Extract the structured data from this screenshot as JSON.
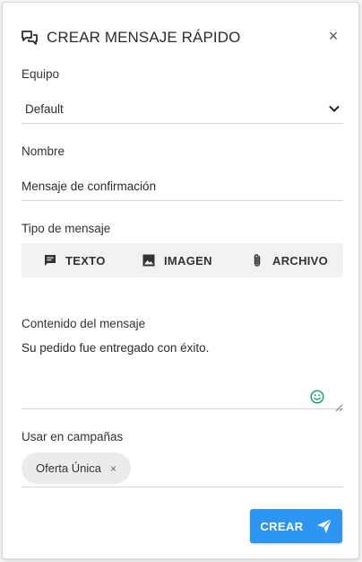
{
  "dialog": {
    "title": "CREAR MENSAJE RÁPIDO",
    "close_label": "×"
  },
  "team": {
    "label": "Equipo",
    "value": "Default"
  },
  "name": {
    "label": "Nombre",
    "value": "Mensaje de confirmación"
  },
  "message_type": {
    "label": "Tipo de mensaje",
    "options": [
      {
        "label": "TEXTO",
        "icon": "message-icon"
      },
      {
        "label": "IMAGEN",
        "icon": "image-icon"
      },
      {
        "label": "ARCHIVO",
        "icon": "paperclip-icon"
      }
    ]
  },
  "content": {
    "label": "Contenido del mensaje",
    "value": "Su pedido fue entregado con éxito."
  },
  "campaigns": {
    "label": "Usar en campañas",
    "chips": [
      {
        "label": "Oferta Única",
        "remove": "×"
      }
    ]
  },
  "actions": {
    "create_label": "CREAR"
  },
  "colors": {
    "primary": "#2d96f3",
    "emoji_green": "#1aa37a"
  }
}
